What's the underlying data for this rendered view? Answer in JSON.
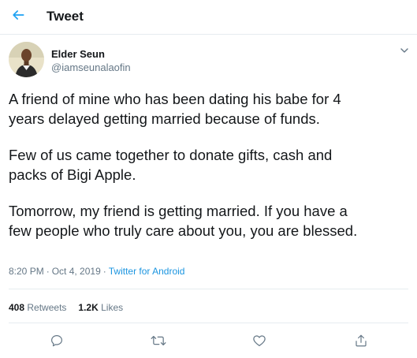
{
  "header": {
    "title": "Tweet"
  },
  "author": {
    "name": "Elder Seun",
    "handle": "@iamseunalaofin"
  },
  "tweet": {
    "paragraphs": [
      [
        "A friend of mine who has been dating his babe for 4",
        "years delayed getting married because of funds."
      ],
      [
        "Few of us came together to donate gifts, cash and",
        "packs of Bigi Apple."
      ],
      [
        "Tomorrow, my friend is getting married. If you have a",
        "few people who truly care about you, you are blessed."
      ]
    ]
  },
  "meta": {
    "time": "8:20 PM",
    "separator": "·",
    "date": "Oct 4, 2019",
    "source": "Twitter for Android"
  },
  "stats": {
    "retweets_count": "408",
    "retweets_label": "Retweets",
    "likes_count": "1.2K",
    "likes_label": "Likes"
  },
  "icons": {
    "back": "back-arrow-icon",
    "caret": "chevron-down-icon",
    "reply": "reply-icon",
    "retweet": "retweet-icon",
    "like": "heart-icon",
    "share": "share-icon"
  },
  "colors": {
    "accent": "#1da1f2",
    "link": "#1b95e0",
    "secondary_text": "#657786",
    "border": "#e6ecf0"
  }
}
